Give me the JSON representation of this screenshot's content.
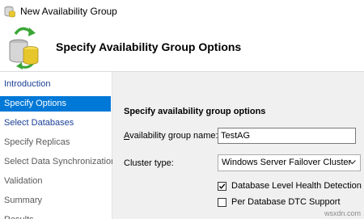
{
  "window": {
    "title": "New Availability Group"
  },
  "header": {
    "title": "Specify Availability Group Options"
  },
  "sidebar": {
    "items": [
      {
        "label": "Introduction",
        "state": "link"
      },
      {
        "label": "Specify Options",
        "state": "active"
      },
      {
        "label": "Select Databases",
        "state": "link"
      },
      {
        "label": "Specify Replicas",
        "state": "disabled"
      },
      {
        "label": "Select Data Synchronization",
        "state": "disabled"
      },
      {
        "label": "Validation",
        "state": "disabled"
      },
      {
        "label": "Summary",
        "state": "disabled"
      },
      {
        "label": "Results",
        "state": "disabled"
      }
    ]
  },
  "main": {
    "section_title": "Specify availability group options",
    "ag_name": {
      "label_accel": "A",
      "label_rest": "vailability group name:",
      "value": "TestAG"
    },
    "cluster_type": {
      "label": "Cluster type:",
      "selected": "Windows Server Failover Cluster"
    },
    "options": [
      {
        "label": "Database Level Health Detection",
        "checked": true
      },
      {
        "label": "Per Database DTC Support",
        "checked": false
      }
    ]
  },
  "watermark": "wsxdn.com",
  "icons": {
    "app": "availability-group-icon",
    "wizard": "database-sync-icon",
    "dropdown": "chevron-down-icon",
    "check": "checkmark-icon"
  },
  "colors": {
    "selection": "#0078d7",
    "link": "#1a3f95",
    "disabled_text": "#5a5a5a"
  }
}
